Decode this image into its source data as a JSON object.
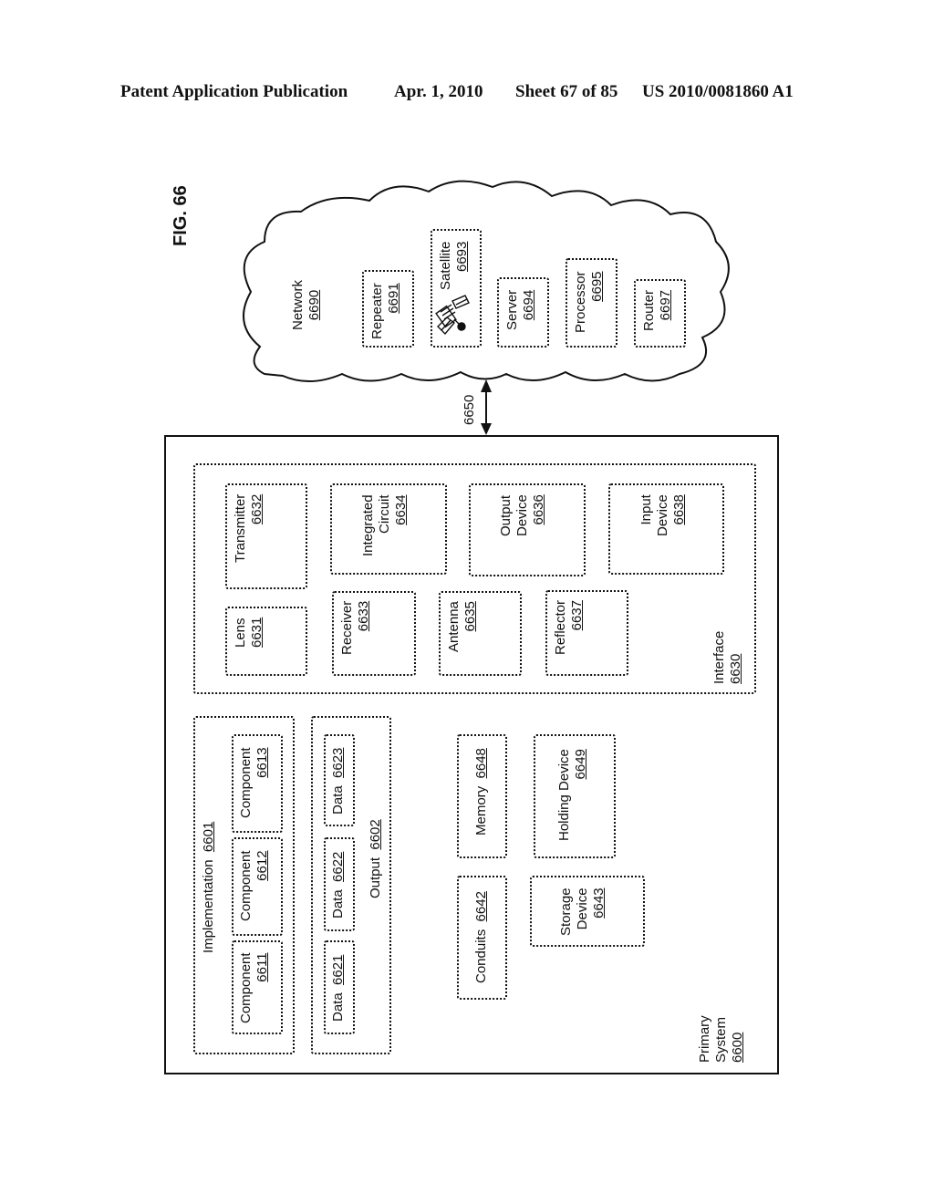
{
  "header": {
    "publication_type": "Patent Application Publication",
    "date": "Apr. 1, 2010",
    "sheet": "Sheet 67 of 85",
    "pub_number": "US 2010/0081860 A1"
  },
  "figure": {
    "label": "FIG. 66"
  },
  "network": {
    "label": "Network",
    "ref": "6690",
    "items": [
      {
        "label": "Repeater",
        "ref": "6691"
      },
      {
        "label": "Satellite",
        "ref": "6693",
        "icon": "satellite-icon"
      },
      {
        "label": "Server",
        "ref": "6694"
      },
      {
        "label": "Processor",
        "ref": "6695"
      },
      {
        "label": "Router",
        "ref": "6697"
      }
    ]
  },
  "link": {
    "ref": "6650"
  },
  "primary_system": {
    "label_line1": "Primary",
    "label_line2": "System",
    "ref": "6600",
    "interface": {
      "label": "Interface",
      "ref": "6630",
      "items": {
        "lens": {
          "label": "Lens",
          "ref": "6631"
        },
        "transmitter": {
          "label": "Transmitter",
          "ref": "6632"
        },
        "receiver": {
          "label": "Receiver",
          "ref": "6633"
        },
        "integrated_circuit": {
          "line1": "Integrated",
          "line2": "Circuit",
          "ref": "6634"
        },
        "antenna": {
          "label": "Antenna",
          "ref": "6635"
        },
        "output_device": {
          "line1": "Output",
          "line2": "Device",
          "ref": "6636"
        },
        "reflector": {
          "label": "Reflector",
          "ref": "6637"
        },
        "input_device": {
          "line1": "Input",
          "line2": "Device",
          "ref": "6638"
        }
      }
    },
    "implementation": {
      "label": "Implementation",
      "ref": "6601",
      "components": [
        {
          "label": "Component",
          "ref": "6611"
        },
        {
          "label": "Component",
          "ref": "6612"
        },
        {
          "label": "Component",
          "ref": "6613"
        }
      ]
    },
    "output": {
      "label": "Output",
      "ref": "6602",
      "data": [
        {
          "label": "Data",
          "ref": "6621"
        },
        {
          "label": "Data",
          "ref": "6622"
        },
        {
          "label": "Data",
          "ref": "6623"
        }
      ]
    },
    "conduits": {
      "label": "Conduits",
      "ref": "6642"
    },
    "storage_device": {
      "line1": "Storage",
      "line2": "Device",
      "ref": "6643"
    },
    "memory": {
      "label": "Memory",
      "ref": "6648"
    },
    "holding_device": {
      "label": "Holding Device",
      "ref": "6649"
    }
  }
}
